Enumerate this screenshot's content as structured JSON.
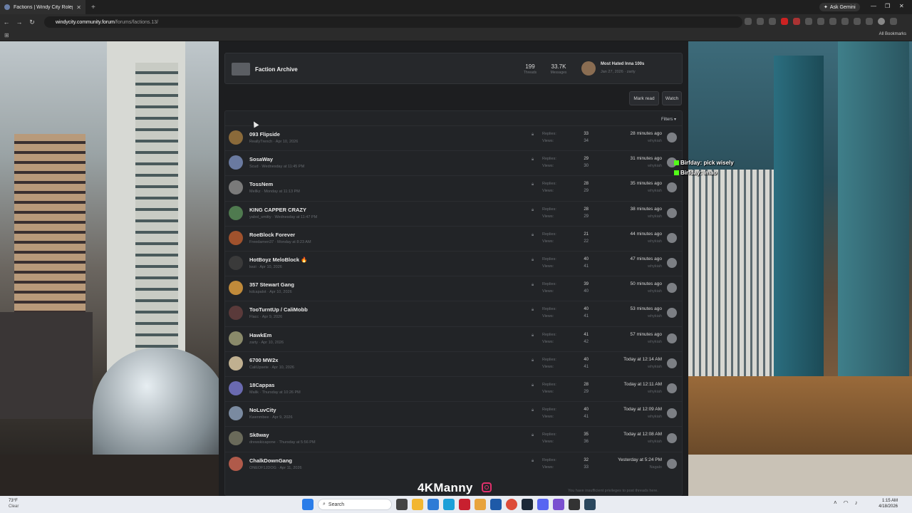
{
  "browser": {
    "tab_title": "Factions | Windy City Roleplay",
    "url_host": "windycity.community.forum",
    "url_path": "/forums/factions.13/",
    "ask_gemini": "Ask Gemini",
    "all_bookmarks": "All Bookmarks"
  },
  "category": {
    "title": "Faction Archive",
    "threads_count": "199",
    "threads_label": "Threads",
    "messages_count": "33.7K",
    "messages_label": "Messages",
    "latest_title": "Most Hated Inna 100s",
    "latest_meta": "Jan 27, 2026 · zarty"
  },
  "actions": {
    "mark_read": "Mark read",
    "watch": "Watch",
    "filters": "Filters ▾"
  },
  "labels": {
    "replies": "Replies:",
    "views": "Views:"
  },
  "threads": [
    {
      "title": "093 Flipside",
      "meta": "ReallyTrench · Apr 10, 2026",
      "replies": "33",
      "views": "34",
      "time": "28 minutes ago",
      "user": "whykiah",
      "avatar_color": "#8a6a3a"
    },
    {
      "title": "SosaWay",
      "meta": "Scud · Wednesday at 11:45 PM",
      "replies": "29",
      "views": "30",
      "time": "31 minutes ago",
      "user": "whykiah",
      "avatar_color": "#6a7aa0"
    },
    {
      "title": "TossNem",
      "meta": "Mellkz · Monday at 11:13 PM",
      "replies": "28",
      "views": "29",
      "time": "35 minutes ago",
      "user": "whykiah",
      "avatar_color": "#7a7a7a"
    },
    {
      "title": "KING CAPPER CRAZY",
      "meta": "yabol_smitty · Wednesday at 11:47 PM",
      "replies": "28",
      "views": "29",
      "time": "38 minutes ago",
      "user": "whykiah",
      "avatar_color": "#4f7a4f"
    },
    {
      "title": "RoeBlock Forever",
      "meta": "Freedamen37 · Monday at 8:23 AM",
      "replies": "21",
      "views": "22",
      "time": "44 minutes ago",
      "user": "whykiah",
      "avatar_color": "#a0522d"
    },
    {
      "title": "HotBoyz MeloBlock 🔥",
      "meta": "kezi · Apr 10, 2026",
      "replies": "40",
      "views": "41",
      "time": "47 minutes ago",
      "user": "whykiah",
      "avatar_color": "#3a3a3a"
    },
    {
      "title": "357 Stewart Gang",
      "meta": "kdcapalot · Apr 10, 2026",
      "replies": "39",
      "views": "40",
      "time": "50 minutes ago",
      "user": "whykiah",
      "avatar_color": "#c08a3a"
    },
    {
      "title": "TooTurntUp / CaliMobb",
      "meta": "Flacc · Apr 9, 2026",
      "replies": "40",
      "views": "41",
      "time": "53 minutes ago",
      "user": "whykiah",
      "avatar_color": "#5a3a3a"
    },
    {
      "title": "HawkEm",
      "meta": "zarty · Apr 10, 2026",
      "replies": "41",
      "views": "42",
      "time": "57 minutes ago",
      "user": "whykiah",
      "avatar_color": "#8a8a6a"
    },
    {
      "title": "6700 MW2x",
      "meta": "CaliUpsete · Apr 10, 2026",
      "replies": "40",
      "views": "41",
      "time": "Today at 12:14 AM",
      "user": "whykiah",
      "avatar_color": "#c0b090"
    },
    {
      "title": "18Cappas",
      "meta": "Malik · Thursday at 10:26 PM",
      "replies": "28",
      "views": "29",
      "time": "Today at 12:11 AM",
      "user": "whykiah",
      "avatar_color": "#6a6ab0"
    },
    {
      "title": "NoLuvCity",
      "meta": "Kwenmbee · Apr 9, 2026",
      "replies": "40",
      "views": "41",
      "time": "Today at 12:09 AM",
      "user": "whykiah",
      "avatar_color": "#7a8aa0"
    },
    {
      "title": "Sk8way",
      "meta": "drewskicapone · Thursday at 5:56 PM",
      "replies": "35",
      "views": "36",
      "time": "Today at 12:08 AM",
      "user": "whykiah",
      "avatar_color": "#6a6a5a"
    },
    {
      "title": "ChalkDownGang",
      "meta": "ONEOF1JDOG · Apr 11, 2026",
      "replies": "32",
      "views": "33",
      "time": "Yesterday at 5:24 PM",
      "user": "Nagalo",
      "avatar_color": "#b05a4a"
    }
  ],
  "footer_note": "You have insufficient privileges to post threads here.",
  "overlay": {
    "watermark": "4KManny",
    "chat": [
      {
        "text": "Birfday: pick wisely"
      },
      {
        "text": "Birfday: lmao"
      }
    ]
  },
  "taskbar": {
    "temp": "73°F",
    "weather": "Clear",
    "search": "Search",
    "time": "1:15 AM",
    "date": "4/18/2026"
  }
}
